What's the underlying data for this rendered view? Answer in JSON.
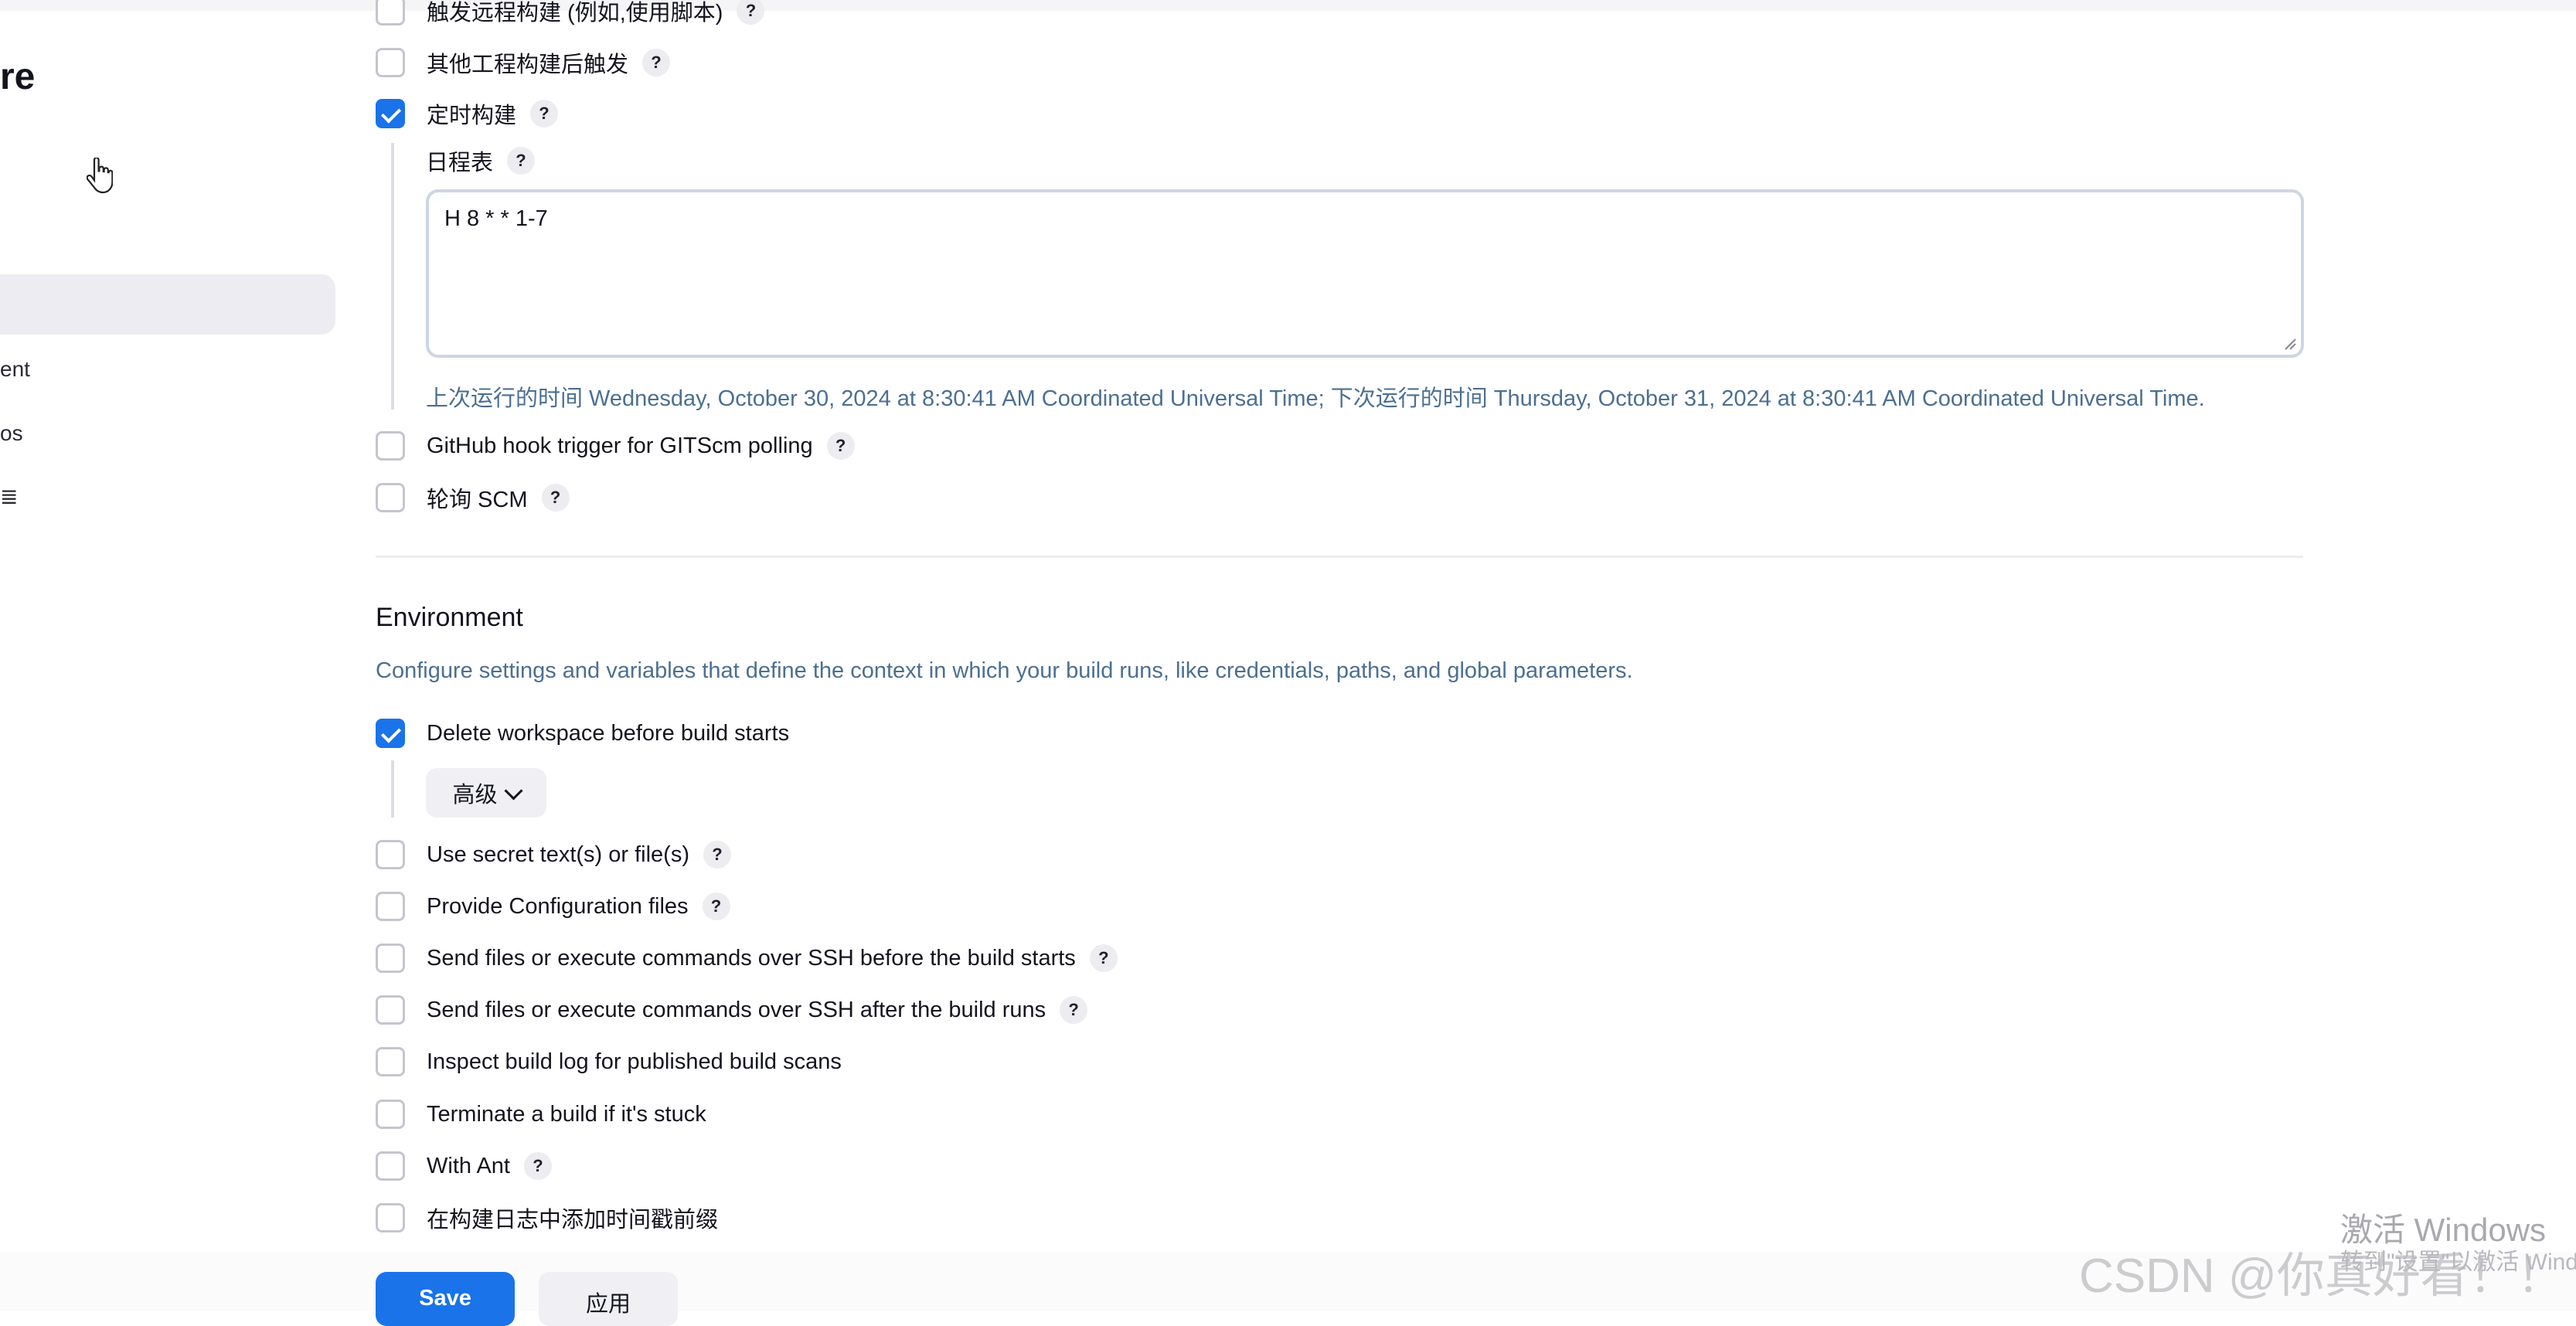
{
  "sidebar": {
    "title_fragment": "re",
    "items": [
      "ent",
      "os",
      "≣"
    ]
  },
  "triggers": {
    "items": [
      {
        "label": "触发远程构建 (例如,使用脚本)",
        "checked": false,
        "help": true
      },
      {
        "label": "其他工程构建后触发",
        "checked": false,
        "help": true
      },
      {
        "label": "定时构建",
        "checked": true,
        "help": true
      }
    ],
    "schedule": {
      "label": "日程表",
      "value": "H 8 * * 1-7",
      "run_info": "上次运行的时间 Wednesday, October 30, 2024 at 8:30:41 AM Coordinated Universal Time; 下次运行的时间 Thursday, October 31, 2024 at 8:30:41 AM Coordinated Universal Time."
    },
    "more": [
      {
        "label": "GitHub hook trigger for GITScm polling",
        "checked": false,
        "help": true
      },
      {
        "label": "轮询 SCM",
        "checked": false,
        "help": true
      }
    ]
  },
  "environment": {
    "title": "Environment",
    "description": "Configure settings and variables that define the context in which your build runs, like credentials, paths, and global parameters.",
    "delete_workspace": {
      "label": "Delete workspace before build starts",
      "checked": true
    },
    "advanced_label": "高级",
    "options": [
      {
        "label": "Use secret text(s) or file(s)",
        "checked": false,
        "help": true
      },
      {
        "label": "Provide Configuration files",
        "checked": false,
        "help": true
      },
      {
        "label": "Send files or execute commands over SSH before the build starts",
        "checked": false,
        "help": true
      },
      {
        "label": "Send files or execute commands over SSH after the build runs",
        "checked": false,
        "help": true
      },
      {
        "label": "Inspect build log for published build scans",
        "checked": false,
        "help": false
      },
      {
        "label": "Terminate a build if it's stuck",
        "checked": false,
        "help": false
      },
      {
        "label": "With Ant",
        "checked": false,
        "help": true
      },
      {
        "label": "在构建日志中添加时间戳前缀",
        "checked": false,
        "help": false
      }
    ]
  },
  "actions": {
    "save": "Save",
    "apply": "应用"
  },
  "help_glyph": "?",
  "watermarks": {
    "windows": "激活 Windows",
    "windows_sub": "转到\"设置\"以激活 Windows。",
    "csdn": "CSDN @你真好看！！"
  },
  "colors": {
    "accent": "#1a73e8",
    "info_text": "#4c6f91"
  }
}
